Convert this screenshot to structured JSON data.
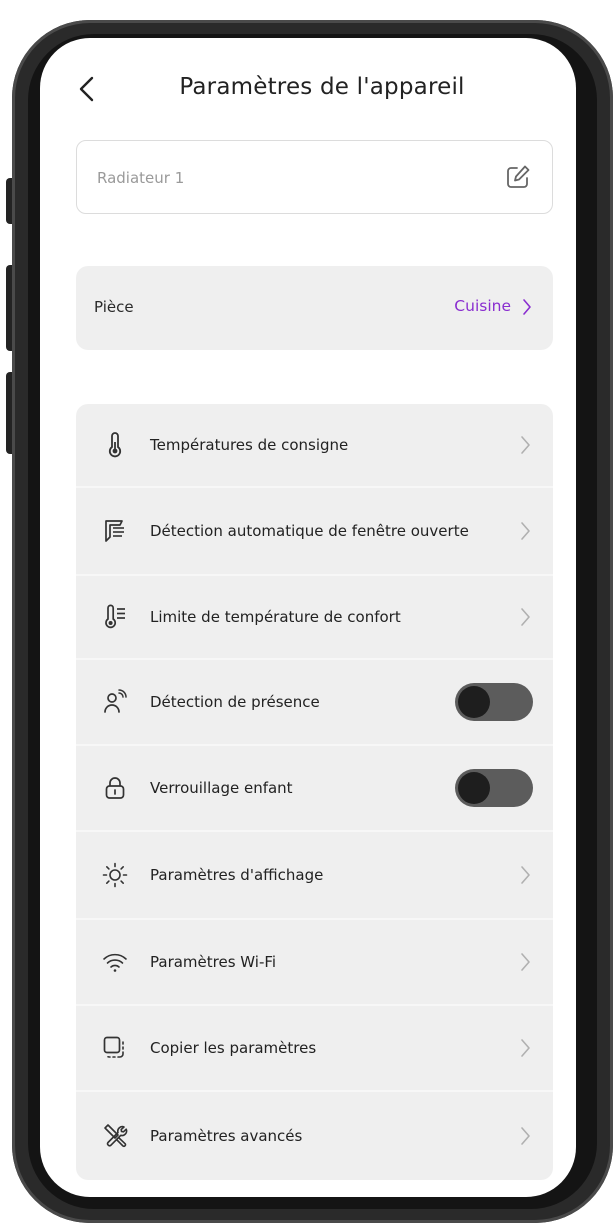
{
  "header": {
    "title": "Paramètres de l'appareil",
    "back_icon": "chevron-left-icon"
  },
  "device_name": {
    "value": "Radiateur 1",
    "edit_icon": "edit-icon"
  },
  "room": {
    "label": "Pièce",
    "value": "Cuisine",
    "accent_color": "#8a2ed0"
  },
  "settings": [
    {
      "label": "Températures de consigne",
      "icon": "thermometer-icon",
      "control": "chevron"
    },
    {
      "label": "Détection automatique de fenêtre ouverte",
      "icon": "window-open-icon",
      "control": "chevron"
    },
    {
      "label": "Limite de température de confort",
      "icon": "thermometer-limit-icon",
      "control": "chevron"
    },
    {
      "label": "Détection de présence",
      "icon": "presence-icon",
      "control": "toggle",
      "on": false
    },
    {
      "label": "Verrouillage enfant",
      "icon": "lock-icon",
      "control": "toggle",
      "on": false
    },
    {
      "label": "Paramètres d'affichage",
      "icon": "sun-icon",
      "control": "chevron"
    },
    {
      "label": "Paramètres Wi-Fi",
      "icon": "wifi-icon",
      "control": "chevron"
    },
    {
      "label": "Copier les paramètres",
      "icon": "copy-icon",
      "control": "chevron"
    },
    {
      "label": "Paramètres avancés",
      "icon": "tools-icon",
      "control": "chevron"
    }
  ]
}
